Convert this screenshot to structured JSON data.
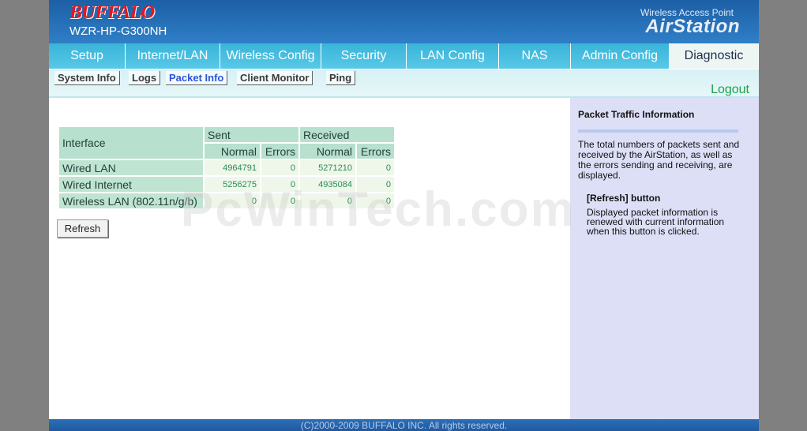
{
  "header": {
    "brand": "BUFFALO",
    "model": "WZR-HP-G300NH",
    "product_sub": "Wireless Access Point",
    "product_name": "AirStation"
  },
  "tabs": [
    {
      "label": "Setup"
    },
    {
      "label": "Internet/LAN"
    },
    {
      "label": "Wireless Config"
    },
    {
      "label": "Security"
    },
    {
      "label": "LAN Config"
    },
    {
      "label": "NAS"
    },
    {
      "label": "Admin Config"
    },
    {
      "label": "Diagnostic",
      "active": true
    }
  ],
  "subnav": {
    "items": [
      {
        "label": "System Info"
      },
      {
        "label": "Logs"
      },
      {
        "label": "Packet Info",
        "active": true
      },
      {
        "label": "Client Monitor"
      },
      {
        "label": "Ping"
      }
    ],
    "logout": "Logout"
  },
  "table": {
    "header": {
      "interface": "Interface",
      "sent": "Sent",
      "received": "Received",
      "normal": "Normal",
      "errors": "Errors"
    },
    "rows": [
      {
        "interface": "Wired LAN",
        "sent_normal": "4964791",
        "sent_errors": "0",
        "recv_normal": "5271210",
        "recv_errors": "0"
      },
      {
        "interface": "Wired Internet",
        "sent_normal": "5256275",
        "sent_errors": "0",
        "recv_normal": "4935084",
        "recv_errors": "0"
      },
      {
        "interface": "Wireless LAN (802.11n/g/b)",
        "sent_normal": "0",
        "sent_errors": "0",
        "recv_normal": "0",
        "recv_errors": "0"
      }
    ]
  },
  "refresh_label": "Refresh",
  "help": {
    "title": "Packet Traffic Information",
    "text": "The total numbers of packets sent and received by the AirStation, as well as the errors sending and receiving, are displayed.",
    "button_title": "[Refresh] button",
    "button_text": "Displayed packet information is renewed with current information when this button is clicked."
  },
  "footer": "(C)2000-2009 BUFFALO INC. All rights reserved.",
  "watermark": "PcWinTech.com",
  "colors": {
    "header_blue": "#1c5fa6",
    "tab_cyan": "#39b4d8",
    "help_bg": "#dddff7",
    "logout_green": "#1fa14b"
  }
}
